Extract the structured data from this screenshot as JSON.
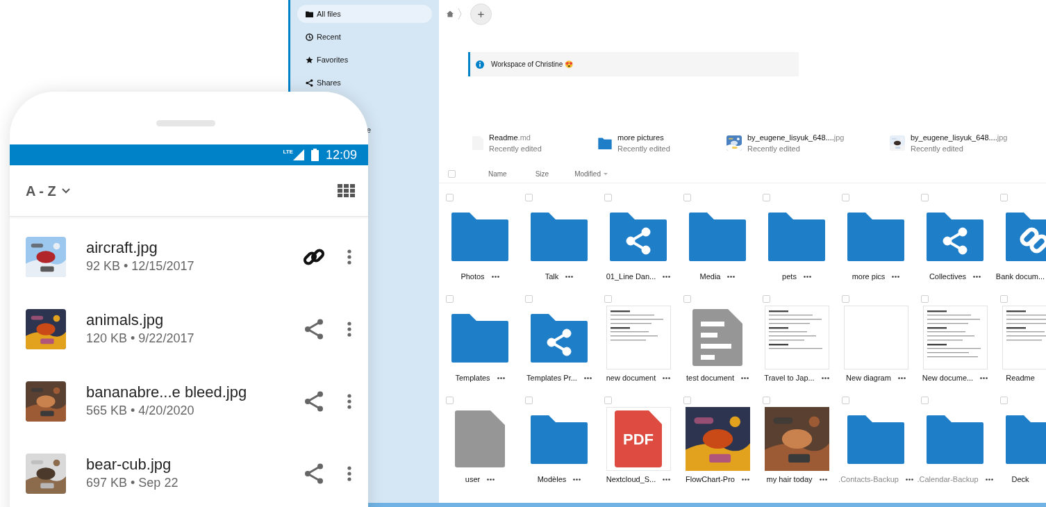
{
  "sidebar": {
    "items": [
      {
        "label": "All files",
        "selected": true,
        "kind": "item"
      },
      {
        "label": "Recent",
        "selected": false,
        "kind": "item"
      },
      {
        "label": "Favorites",
        "selected": false,
        "kind": "item"
      },
      {
        "label": "Shares",
        "selected": false,
        "kind": "item"
      },
      {
        "label": "e",
        "selected": false,
        "kind": "covered"
      }
    ]
  },
  "breadcrumb": {
    "add_label": "+"
  },
  "notice": {
    "text": "Workspace of Christine 😍"
  },
  "recent": [
    {
      "name": "Readme",
      "ext": ".md",
      "sub": "Recently edited",
      "kind": "file"
    },
    {
      "name": "more pictures",
      "sub": "Recently edited",
      "kind": "folder"
    },
    {
      "name": "by_eugene_lisyuk_648....",
      "ext": "jpg",
      "sub": "Recently edited",
      "kind": "picture"
    },
    {
      "name": "by_eugene_lisyuk_648....",
      "ext": "jpg",
      "sub": "Recently edited",
      "kind": "picture"
    }
  ],
  "table": {
    "checked": false,
    "columns": [
      {
        "label": "Name",
        "sorted": false
      },
      {
        "label": "Size",
        "sorted": false
      },
      {
        "label": "Modified",
        "sorted": true
      }
    ]
  },
  "grid": [
    {
      "name": "Photos",
      "kind": "folder",
      "checked": false,
      "hidden": false,
      "has_menu": true
    },
    {
      "name": "Talk",
      "kind": "folder",
      "checked": false,
      "hidden": false,
      "has_menu": true
    },
    {
      "name": "01_Line Dan...",
      "kind": "folder-shared",
      "checked": false,
      "hidden": false,
      "has_menu": true
    },
    {
      "name": "Media",
      "kind": "folder",
      "checked": false,
      "hidden": false,
      "has_menu": true
    },
    {
      "name": "pets",
      "kind": "folder",
      "checked": false,
      "hidden": false,
      "has_menu": true
    },
    {
      "name": "more pics",
      "kind": "folder",
      "checked": false,
      "hidden": false,
      "has_menu": true
    },
    {
      "name": "Collectives",
      "kind": "folder-shared",
      "checked": false,
      "hidden": false,
      "has_menu": true
    },
    {
      "name": "Bank docum...",
      "kind": "folder-link",
      "checked": false,
      "hidden": false,
      "has_menu": false
    },
    {
      "name": "Templates",
      "kind": "folder",
      "checked": false,
      "hidden": false,
      "has_menu": true
    },
    {
      "name": "Templates Pr...",
      "kind": "folder-shared",
      "checked": false,
      "hidden": false,
      "has_menu": true
    },
    {
      "name": "new document",
      "kind": "doc",
      "checked": false,
      "hidden": false,
      "has_menu": true
    },
    {
      "name": "test document",
      "kind": "textfile",
      "checked": false,
      "hidden": false,
      "has_menu": true
    },
    {
      "name": "Travel to Jap...",
      "kind": "doc",
      "checked": false,
      "hidden": false,
      "has_menu": true
    },
    {
      "name": "New diagram",
      "kind": "blank",
      "checked": false,
      "hidden": false,
      "has_menu": true
    },
    {
      "name": "New docume...",
      "kind": "doc",
      "checked": false,
      "hidden": false,
      "has_menu": true
    },
    {
      "name": "Readme",
      "kind": "doc",
      "checked": false,
      "hidden": false,
      "has_menu": false
    },
    {
      "name": "user",
      "kind": "file",
      "checked": false,
      "hidden": false,
      "has_menu": true
    },
    {
      "name": "Modèles",
      "kind": "folder",
      "checked": false,
      "hidden": false,
      "has_menu": true
    },
    {
      "name": "Nextcloud_S...",
      "kind": "pdf",
      "badge": "PDF",
      "checked": false,
      "hidden": false,
      "has_menu": true
    },
    {
      "name": "FlowChart-Pro",
      "kind": "picture",
      "checked": false,
      "hidden": false,
      "has_menu": true
    },
    {
      "name": "my hair today",
      "kind": "picture",
      "checked": false,
      "hidden": false,
      "has_menu": true
    },
    {
      "name": ".Contacts-Backup",
      "kind": "folder",
      "checked": false,
      "hidden": true,
      "has_menu": true
    },
    {
      "name": ".Calendar-Backup",
      "kind": "folder",
      "checked": false,
      "hidden": true,
      "has_menu": true
    },
    {
      "name": "Deck",
      "kind": "folder",
      "checked": false,
      "hidden": false,
      "has_menu": false
    }
  ],
  "phone": {
    "status_bar": {
      "network": "LTE",
      "time": "12:09"
    },
    "sort": "A - Z",
    "files": [
      {
        "name": "aircraft.jpg",
        "meta": "92 KB • 12/15/2017",
        "kind": "link"
      },
      {
        "name": "animals.jpg",
        "meta": "120 KB • 9/22/2017",
        "kind": "share"
      },
      {
        "name": "bananabre...e bleed.jpg",
        "meta": "565 KB • 4/20/2020",
        "kind": "share"
      },
      {
        "name": "bear-cub.jpg",
        "meta": "697 KB • Sep 22",
        "kind": "share"
      }
    ]
  }
}
